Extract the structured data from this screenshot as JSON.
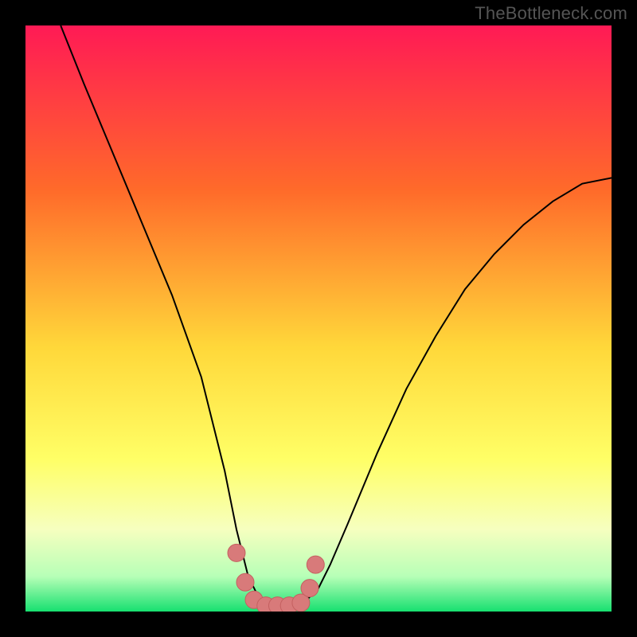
{
  "watermark": "TheBottleneck.com",
  "colors": {
    "frame": "#000000",
    "gradient_top": "#ff1a55",
    "gradient_mid1": "#ff6a2a",
    "gradient_mid2": "#ffd83a",
    "gradient_mid3": "#ffff66",
    "gradient_mid4": "#f6ffbf",
    "gradient_mid5": "#b7ffb7",
    "gradient_bottom": "#17e070",
    "curve": "#000000",
    "marker_fill": "#d87a7a",
    "marker_stroke": "#c46060"
  },
  "chart_data": {
    "type": "line",
    "title": "",
    "xlabel": "",
    "ylabel": "",
    "xlim": [
      0,
      100
    ],
    "ylim": [
      0,
      100
    ],
    "grid": false,
    "legend": false,
    "series": [
      {
        "name": "bottleneck-curve",
        "comment": "V-shaped bottleneck percentage curve. Values are approximate, read off the vertical position relative to the gradient (top≈100, bottom≈0).",
        "x": [
          6,
          10,
          15,
          20,
          25,
          30,
          34,
          36,
          38,
          40,
          42,
          44,
          46,
          48,
          50,
          52,
          55,
          60,
          65,
          70,
          75,
          80,
          85,
          90,
          95,
          100
        ],
        "y": [
          100,
          90,
          78,
          66,
          54,
          40,
          24,
          14,
          6,
          2,
          1,
          1,
          1,
          2,
          4,
          8,
          15,
          27,
          38,
          47,
          55,
          61,
          66,
          70,
          73,
          74
        ]
      }
    ],
    "markers": {
      "comment": "Pink rounded markers near the valley floor",
      "points": [
        {
          "x": 36.0,
          "y": 10.0
        },
        {
          "x": 37.5,
          "y": 5.0
        },
        {
          "x": 39.0,
          "y": 2.0
        },
        {
          "x": 41.0,
          "y": 1.0
        },
        {
          "x": 43.0,
          "y": 1.0
        },
        {
          "x": 45.0,
          "y": 1.0
        },
        {
          "x": 47.0,
          "y": 1.5
        },
        {
          "x": 48.5,
          "y": 4.0
        },
        {
          "x": 49.5,
          "y": 8.0
        }
      ]
    }
  }
}
